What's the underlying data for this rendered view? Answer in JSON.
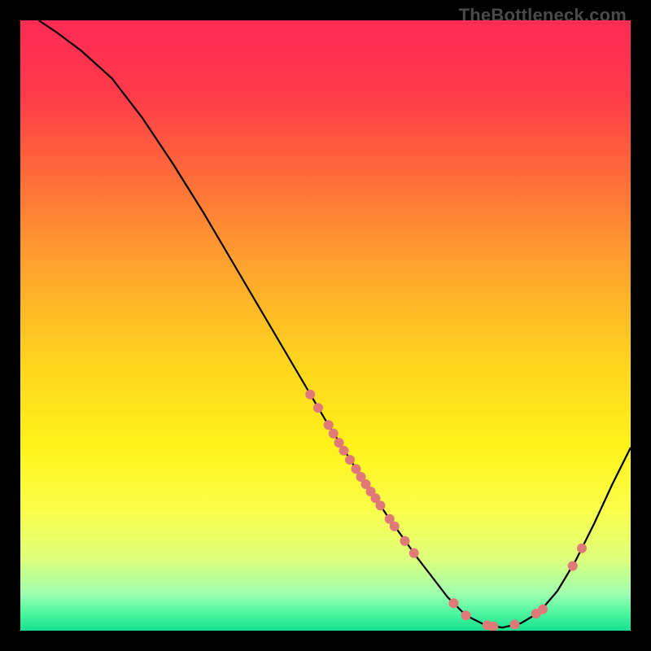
{
  "watermark": "TheBottleneck.com",
  "chart_data": {
    "type": "line",
    "title": "",
    "xlabel": "",
    "ylabel": "",
    "xlim": [
      0,
      100
    ],
    "ylim": [
      0,
      100
    ],
    "background_gradient": {
      "stops": [
        {
          "offset": 0.0,
          "color": "#ff2b54"
        },
        {
          "offset": 0.12,
          "color": "#ff3a4a"
        },
        {
          "offset": 0.25,
          "color": "#ff6a3a"
        },
        {
          "offset": 0.4,
          "color": "#ffa22f"
        },
        {
          "offset": 0.55,
          "color": "#ffd21f"
        },
        {
          "offset": 0.7,
          "color": "#fff31a"
        },
        {
          "offset": 0.8,
          "color": "#fbff4a"
        },
        {
          "offset": 0.88,
          "color": "#dfff7a"
        },
        {
          "offset": 0.94,
          "color": "#9fffb0"
        },
        {
          "offset": 0.97,
          "color": "#50f7a0"
        },
        {
          "offset": 1.0,
          "color": "#14e08e"
        }
      ]
    },
    "series": [
      {
        "name": "bottleneck-curve",
        "color": "#000000",
        "width": 2.2,
        "points": [
          {
            "x": 3.0,
            "y": 100.0
          },
          {
            "x": 6.0,
            "y": 98.0
          },
          {
            "x": 10.0,
            "y": 95.0
          },
          {
            "x": 15.0,
            "y": 90.5
          },
          {
            "x": 20.0,
            "y": 84.0
          },
          {
            "x": 25.0,
            "y": 76.5
          },
          {
            "x": 30.0,
            "y": 68.5
          },
          {
            "x": 35.0,
            "y": 60.0
          },
          {
            "x": 40.0,
            "y": 51.5
          },
          {
            "x": 45.0,
            "y": 43.0
          },
          {
            "x": 50.0,
            "y": 34.5
          },
          {
            "x": 55.0,
            "y": 26.5
          },
          {
            "x": 60.0,
            "y": 19.0
          },
          {
            "x": 65.0,
            "y": 12.0
          },
          {
            "x": 70.0,
            "y": 5.5
          },
          {
            "x": 73.0,
            "y": 2.5
          },
          {
            "x": 76.0,
            "y": 1.0
          },
          {
            "x": 79.0,
            "y": 0.5
          },
          {
            "x": 82.0,
            "y": 1.2
          },
          {
            "x": 85.0,
            "y": 3.0
          },
          {
            "x": 88.0,
            "y": 6.5
          },
          {
            "x": 91.0,
            "y": 11.5
          },
          {
            "x": 94.0,
            "y": 17.5
          },
          {
            "x": 97.0,
            "y": 24.0
          },
          {
            "x": 100.0,
            "y": 30.0
          }
        ]
      }
    ],
    "scatter": {
      "name": "highlighted-points",
      "color": "#e07a78",
      "radius": 6,
      "points": [
        {
          "x": 47.5,
          "y": 38.7
        },
        {
          "x": 48.8,
          "y": 36.5
        },
        {
          "x": 50.5,
          "y": 33.7
        },
        {
          "x": 51.3,
          "y": 32.3
        },
        {
          "x": 52.2,
          "y": 30.8
        },
        {
          "x": 53.0,
          "y": 29.5
        },
        {
          "x": 54.0,
          "y": 28.0
        },
        {
          "x": 55.0,
          "y": 26.5
        },
        {
          "x": 55.8,
          "y": 25.2
        },
        {
          "x": 56.6,
          "y": 24.0
        },
        {
          "x": 57.4,
          "y": 22.8
        },
        {
          "x": 58.2,
          "y": 21.7
        },
        {
          "x": 59.0,
          "y": 20.5
        },
        {
          "x": 60.5,
          "y": 18.3
        },
        {
          "x": 61.3,
          "y": 17.1
        },
        {
          "x": 63.0,
          "y": 14.7
        },
        {
          "x": 64.5,
          "y": 12.7
        },
        {
          "x": 71.0,
          "y": 4.5
        },
        {
          "x": 73.0,
          "y": 2.5
        },
        {
          "x": 76.5,
          "y": 0.9
        },
        {
          "x": 77.5,
          "y": 0.7
        },
        {
          "x": 81.0,
          "y": 1.0
        },
        {
          "x": 84.5,
          "y": 2.8
        },
        {
          "x": 85.6,
          "y": 3.5
        },
        {
          "x": 90.5,
          "y": 10.6
        },
        {
          "x": 92.0,
          "y": 13.5
        }
      ]
    }
  }
}
